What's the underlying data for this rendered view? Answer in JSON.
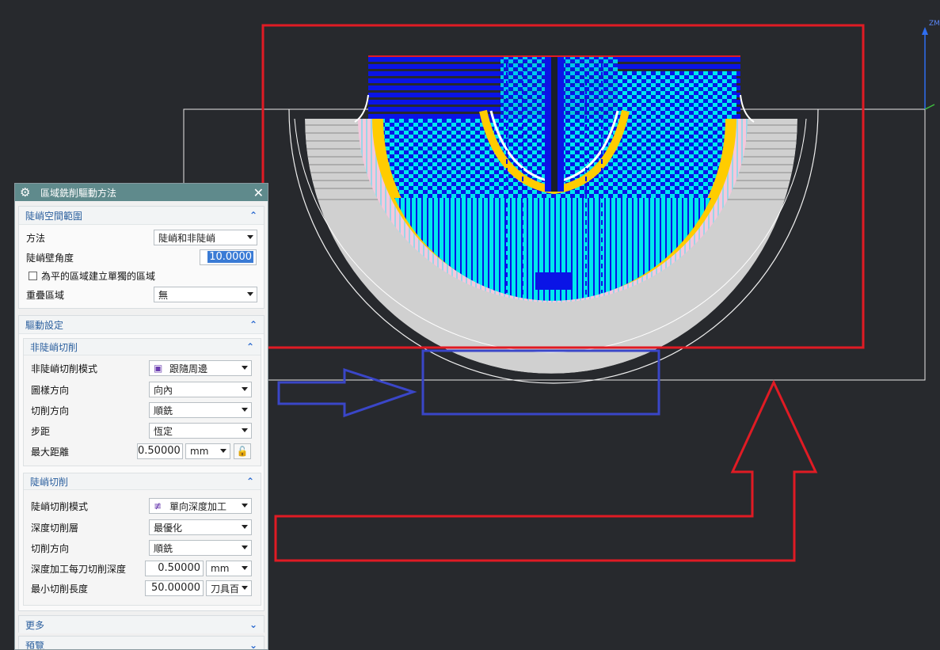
{
  "axis": {
    "z_label": "ZM"
  },
  "dialog": {
    "title": "區域銑削驅動方法",
    "groups": {
      "steep_space": {
        "header": "陡峭空間範圍",
        "method_label": "方法",
        "method_value": "陡峭和非陡峭",
        "angle_label": "陡峭壁角度",
        "angle_value": "10.0000",
        "flat_checkbox_label": "為平的區域建立單獨的區域",
        "overlap_label": "重疊區域",
        "overlap_value": "無"
      },
      "drive": {
        "header": "驅動設定",
        "non_steep": {
          "header": "非陡峭切削",
          "mode_label": "非陡峭切削模式",
          "mode_value": "跟隨周邊",
          "pattern_label": "圖樣方向",
          "pattern_value": "向內",
          "cut_dir_label": "切削方向",
          "cut_dir_value": "順銑",
          "stepover_label": "步距",
          "stepover_value": "恆定",
          "max_dist_label": "最大距離",
          "max_dist_value": "0.50000",
          "max_dist_unit": "mm"
        },
        "steep": {
          "header": "陡峭切削",
          "mode_label": "陡峭切削模式",
          "mode_value": "單向深度加工",
          "depth_layer_label": "深度切削層",
          "depth_layer_value": "最優化",
          "cut_dir_label": "切削方向",
          "cut_dir_value": "順銑",
          "depth_per_cut_label": "深度加工每刀切削深度",
          "depth_per_cut_value": "0.50000",
          "depth_per_cut_unit": "mm",
          "min_len_label": "最小切削長度",
          "min_len_value": "50.00000",
          "min_len_unit": "刀具百"
        }
      },
      "more": {
        "header": "更多"
      },
      "preview": {
        "header": "預覽"
      }
    }
  },
  "colors": {
    "background": "#27292d",
    "toolpath_blue": "#0a14e6",
    "toolpath_cyan": "#00e8ee",
    "toolpath_yellow": "#ffcc00",
    "toolpath_pink": "#f4c8dc",
    "part_gray": "#d0d0d0",
    "annotation_red": "#e01b24",
    "annotation_blue": "#3a46c8",
    "dialog_title": "#5f8a8c",
    "header_text": "#2b5f9e"
  }
}
